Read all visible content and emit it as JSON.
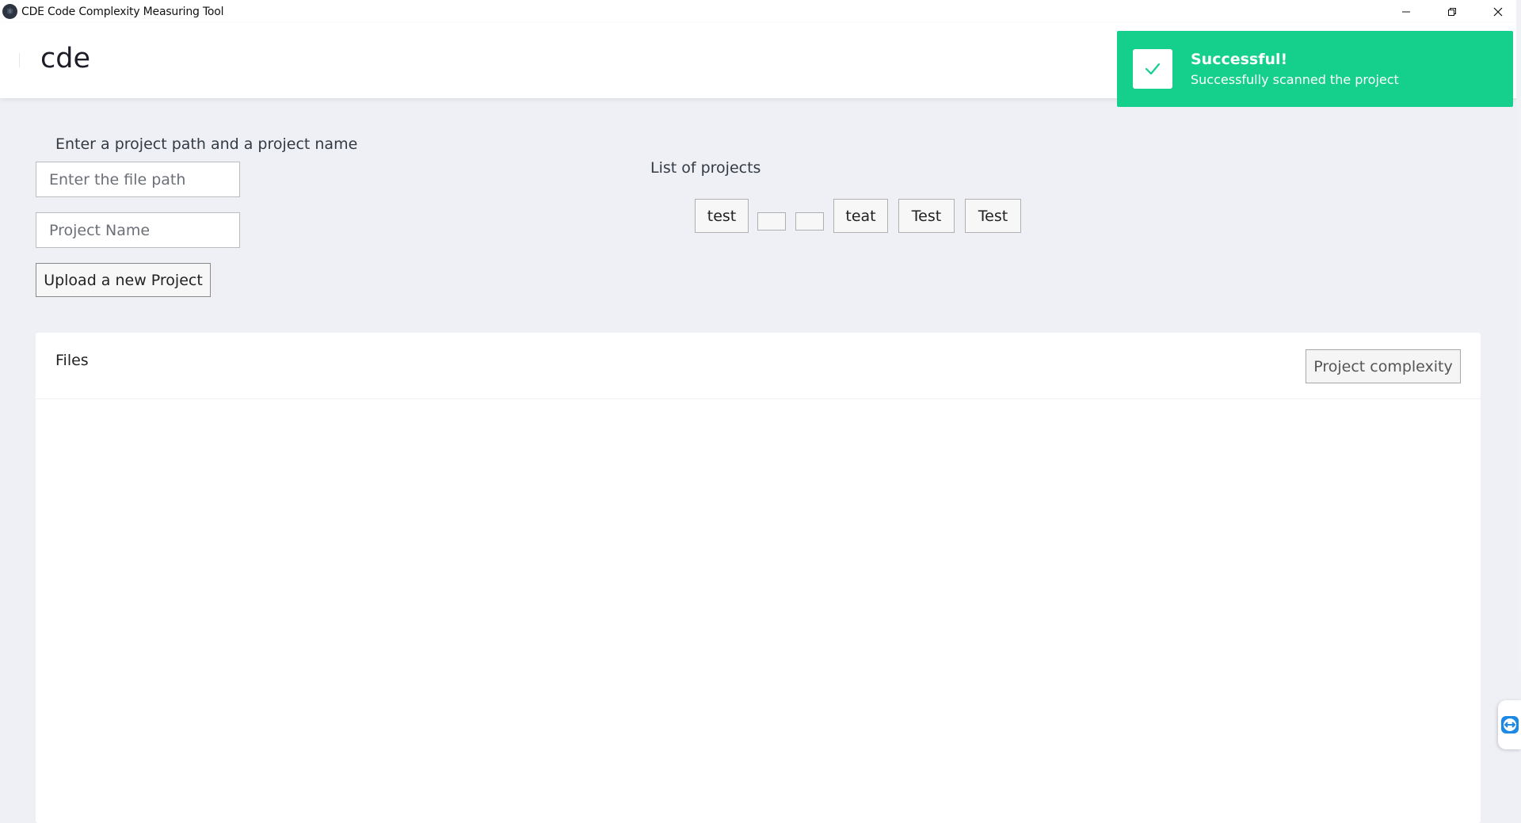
{
  "window": {
    "title": "CDE Code Complexity Measuring Tool"
  },
  "header": {
    "brand": "cde"
  },
  "toast": {
    "title": "Successful!",
    "message": "Successfully scanned the project",
    "color": "#14d08c"
  },
  "form": {
    "label": "Enter a project path and a project name",
    "path_placeholder": "Enter the file path",
    "path_value": "",
    "name_placeholder": "Project Name",
    "name_value": "",
    "upload_label": "Upload a new Project"
  },
  "projects": {
    "label": "List of projects",
    "items": [
      "test",
      "",
      "",
      "teat",
      "Test",
      "Test"
    ]
  },
  "files": {
    "title": "Files",
    "complexity_label": "Project complexity"
  },
  "colors": {
    "background": "#eef0f6",
    "accent": "#14d08c"
  }
}
